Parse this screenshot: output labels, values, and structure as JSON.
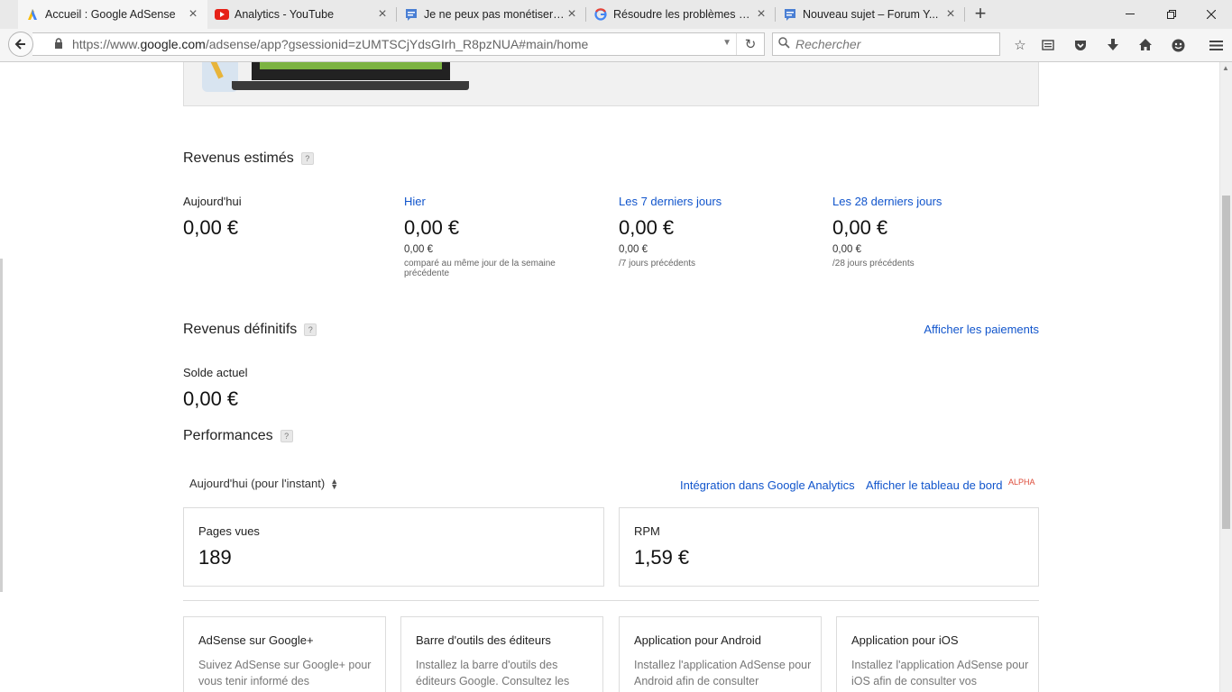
{
  "browser": {
    "tabs": [
      {
        "title": "Accueil : Google AdSense",
        "icon": "adsense-icon",
        "active": true
      },
      {
        "title": "Analytics - YouTube",
        "icon": "youtube-icon",
        "active": false
      },
      {
        "title": "Je ne peux pas monétiser ...",
        "icon": "forum-icon",
        "active": false
      },
      {
        "title": "Résoudre les problèmes d...",
        "icon": "google-icon",
        "active": false
      },
      {
        "title": "Nouveau sujet – Forum Y...",
        "icon": "forum-icon",
        "active": false
      }
    ],
    "url_prefix": "https://www.",
    "url_domain": "google.com",
    "url_path": "/adsense/app?gsessionid=zUMTSCjYdsGIrh_R8pzNUA#main/home",
    "search_placeholder": "Rechercher"
  },
  "estimated": {
    "title": "Revenus estimés",
    "help": "?",
    "columns": [
      {
        "label": "Aujourd'hui",
        "value": "0,00 €",
        "is_link": false,
        "compare_value": "",
        "compare_text": ""
      },
      {
        "label": "Hier",
        "value": "0,00 €",
        "is_link": true,
        "compare_value": "0,00 €",
        "compare_text": "comparé au même jour de la semaine précédente"
      },
      {
        "label": "Les 7 derniers jours",
        "value": "0,00 €",
        "is_link": true,
        "compare_value": "0,00 €",
        "compare_text": "/7 jours précédents"
      },
      {
        "label": "Les 28 derniers jours",
        "value": "0,00 €",
        "is_link": true,
        "compare_value": "0,00 €",
        "compare_text": "/28 jours précédents"
      }
    ]
  },
  "finalized": {
    "title": "Revenus définitifs",
    "help": "?",
    "payments_link": "Afficher les paiements",
    "balance_label": "Solde actuel",
    "balance_value": "0,00 €"
  },
  "performance": {
    "title": "Performances",
    "help": "?",
    "period": "Aujourd'hui (pour l'instant)",
    "analytics_link": "Intégration dans Google Analytics",
    "dashboard_link": "Afficher le tableau de bord",
    "alpha_badge": "ALPHA",
    "metrics": [
      {
        "label": "Pages vues",
        "value": "189"
      },
      {
        "label": "RPM",
        "value": "1,59 €"
      }
    ]
  },
  "promos": [
    {
      "title": "AdSense sur Google+",
      "desc": "Suivez AdSense sur Google+ pour vous tenir informé des"
    },
    {
      "title": "Barre d'outils des éditeurs",
      "desc": "Installez la barre d'outils des éditeurs Google. Consultez les"
    },
    {
      "title": "Application pour Android",
      "desc": "Installez l'application AdSense pour Android afin de consulter"
    },
    {
      "title": "Application pour iOS",
      "desc": "Installez l'application AdSense pour iOS afin de consulter vos"
    }
  ],
  "colors": {
    "link": "#1155cc",
    "alpha": "#dd4b39",
    "banner_green": "#7cb342"
  }
}
